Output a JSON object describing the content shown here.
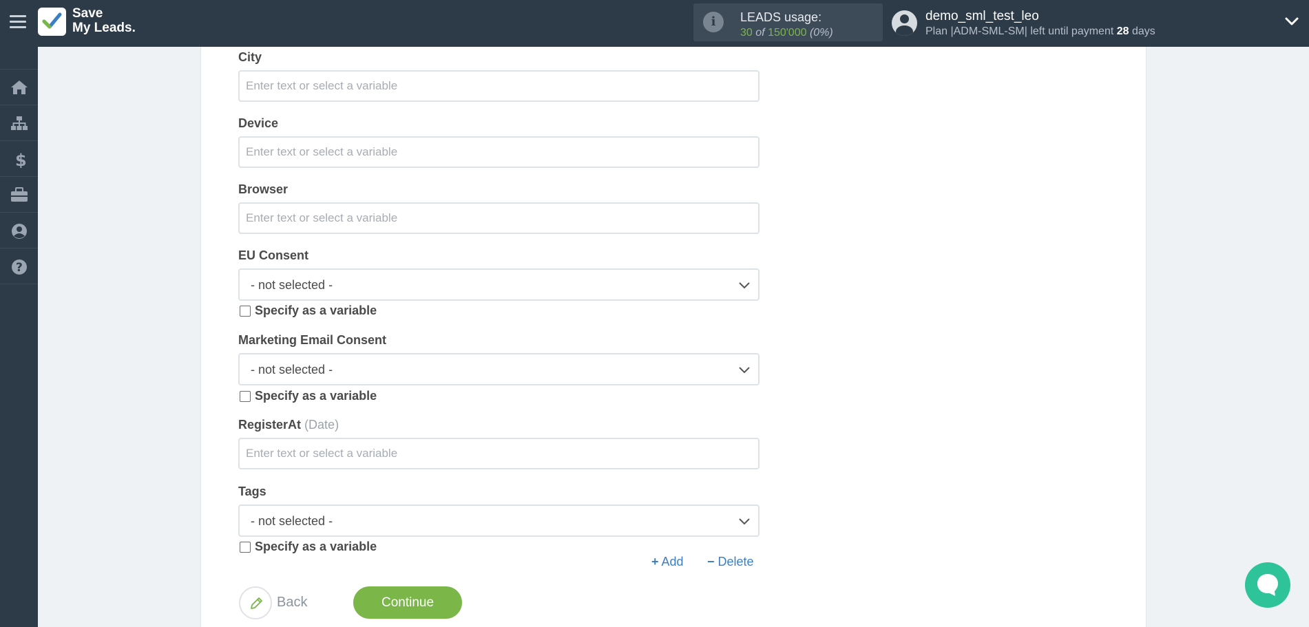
{
  "header": {
    "brand_line1": "Save",
    "brand_line2": "My Leads.",
    "usage": {
      "title": "LEADS usage:",
      "used": "30",
      "of": "of",
      "total": "150'000",
      "percent": "(0%)"
    },
    "user": {
      "name": "demo_sml_test_leo",
      "plan_prefix": "Plan |ADM-SML-SM| left until payment",
      "days": "28",
      "days_suffix": "days"
    }
  },
  "sidebar": {
    "items": [
      {
        "icon": "home-icon"
      },
      {
        "icon": "sitemap-icon"
      },
      {
        "icon": "dollar-icon"
      },
      {
        "icon": "briefcase-icon"
      },
      {
        "icon": "user-circle-icon"
      },
      {
        "icon": "help-icon"
      }
    ]
  },
  "form": {
    "city": {
      "label": "City",
      "placeholder": "Enter text or select a variable"
    },
    "device": {
      "label": "Device",
      "placeholder": "Enter text or select a variable"
    },
    "browser": {
      "label": "Browser",
      "placeholder": "Enter text or select a variable"
    },
    "eu_consent": {
      "label": "EU Consent",
      "value": "- not selected -",
      "checkbox": "Specify as a variable"
    },
    "marketing_consent": {
      "label": "Marketing Email Consent",
      "value": "- not selected -",
      "checkbox": "Specify as a variable"
    },
    "register_at": {
      "label": "RegisterAt",
      "hint": "(Date)",
      "placeholder": "Enter text or select a variable"
    },
    "tags": {
      "label": "Tags",
      "value": "- not selected -",
      "checkbox": "Specify as a variable"
    },
    "add_label": "Add",
    "delete_label": "Delete",
    "back_label": "Back",
    "continue_label": "Continue"
  },
  "colors": {
    "topbar": "#2d3a48",
    "accent_green": "#7ab648",
    "link_blue": "#3a7fc4",
    "chat_teal": "#2fc39a"
  }
}
